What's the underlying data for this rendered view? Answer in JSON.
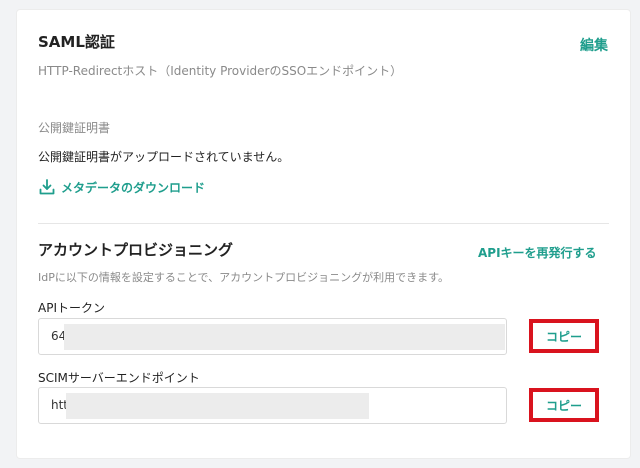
{
  "saml": {
    "title": "SAML認証",
    "edit_label": "編集",
    "subtitle": "HTTP-Redirectホスト（Identity ProviderのSSOエンドポイント）",
    "cert_label": "公開鍵証明書",
    "cert_status": "公開鍵証明書がアップロードされていません。",
    "download_label": "メタデータのダウンロード"
  },
  "provisioning": {
    "title": "アカウントプロビジョニング",
    "reissue_label": "APIキーを再発行する",
    "description": "IdPに以下の情報を設定することで、アカウントプロビジョニングが利用できます。",
    "api_token": {
      "label": "APIトークン",
      "value": "64",
      "copy_label": "コピー"
    },
    "scim_endpoint": {
      "label": "SCIMサーバーエンドポイント",
      "value": "htt",
      "copy_label": "コピー"
    }
  },
  "icons": {
    "download": "download-icon"
  },
  "colors": {
    "accent": "#1f9e8d",
    "highlight": "#d9131e",
    "muted_text": "#8a8a8a"
  }
}
